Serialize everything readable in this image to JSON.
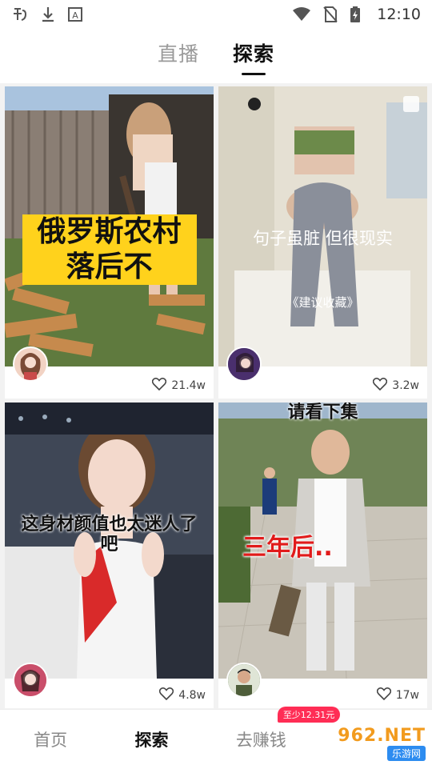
{
  "status_bar": {
    "time": "12:10",
    "left_icons": [
      "app-icon",
      "download-icon",
      "font-icon"
    ],
    "right_icons": [
      "wifi-icon",
      "no-sim-icon",
      "battery-charging-icon"
    ]
  },
  "top_tabs": [
    {
      "label": "直播",
      "active": false
    },
    {
      "label": "探索",
      "active": true
    }
  ],
  "cards": [
    {
      "caption": "俄罗斯农村落后不",
      "likes": "21.4w",
      "icon": "heart-icon"
    },
    {
      "caption": "句子虽脏 但很现实",
      "subcaption": "《建议收藏》",
      "likes": "3.2w",
      "icon": "heart-icon"
    },
    {
      "caption": "这身材颜值也太迷人了吧",
      "likes": "4.8w",
      "icon": "heart-icon"
    },
    {
      "caption_top": "请看下集",
      "caption": "三年后..",
      "likes": "17w",
      "icon": "heart-icon"
    }
  ],
  "bottom_nav": {
    "items": [
      {
        "label": "首页",
        "active": false
      },
      {
        "label": "探索",
        "active": true
      },
      {
        "label": "去赚钱",
        "active": false
      }
    ],
    "badge": "至少12.31元"
  },
  "watermark": {
    "top": "962.NET",
    "bottom": "乐游网"
  },
  "colors": {
    "accent": "#ff2d55",
    "background": "#f2f2f2",
    "active_text": "#111111",
    "inactive_text": "#9a9a9a"
  }
}
